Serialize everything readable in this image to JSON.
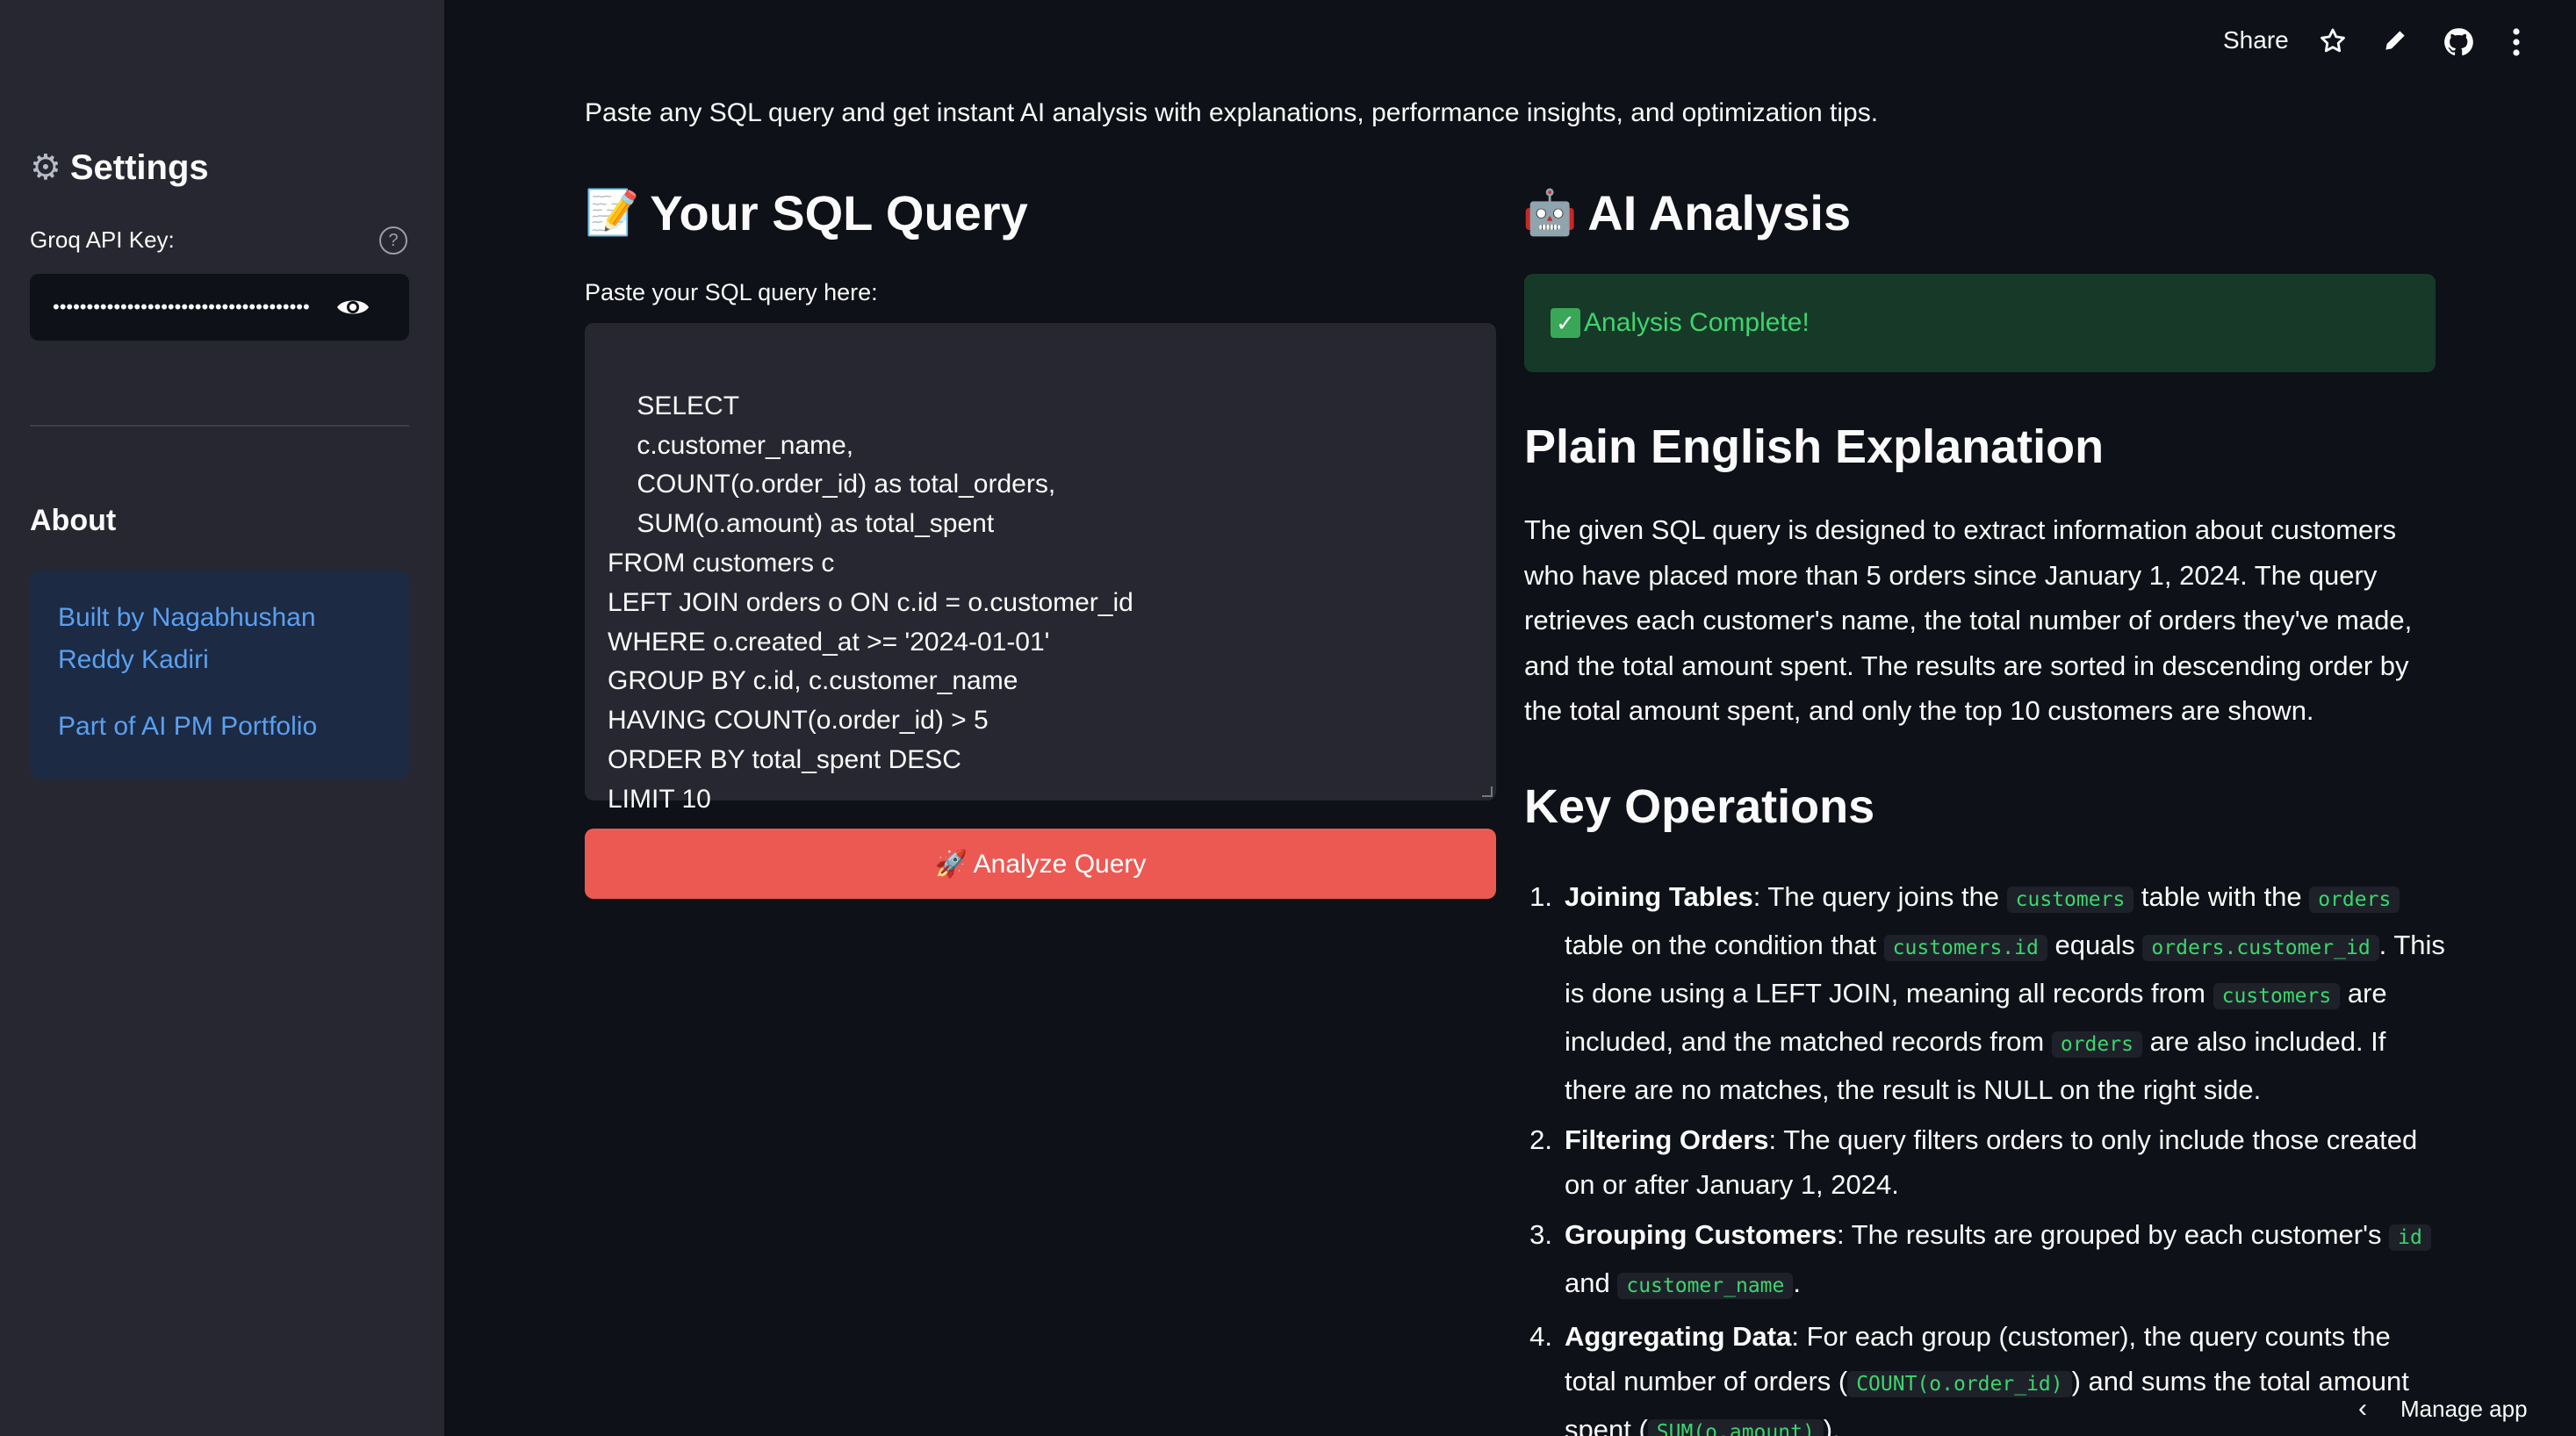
{
  "sidebar": {
    "settings_title": "Settings",
    "api_key_label": "Groq API Key:",
    "api_key_value": "••••••••••••••••••••••••••••••••••••••",
    "about_title": "About",
    "author_link": "Built by Nagabhushan Reddy Kadiri",
    "portfolio_link": "Part of AI PM Portfolio"
  },
  "header": {
    "share_label": "Share"
  },
  "main": {
    "intro": "Paste any SQL query and get instant AI analysis with explanations, performance insights, and optimization tips.",
    "left_heading": "Your SQL Query",
    "left_heading_emoji": "📝",
    "input_label": "Paste your SQL query here:",
    "sql_query": "SELECT\n    c.customer_name,\n    COUNT(o.order_id) as total_orders,\n    SUM(o.amount) as total_spent\nFROM customers c\nLEFT JOIN orders o ON c.id = o.customer_id\nWHERE o.created_at >= '2024-01-01'\nGROUP BY c.id, c.customer_name\nHAVING COUNT(o.order_id) > 5\nORDER BY total_spent DESC\nLIMIT 10",
    "analyze_button": "🚀 Analyze Query",
    "right_heading": "AI Analysis",
    "right_heading_emoji": "🤖",
    "success_message": "Analysis Complete!",
    "explanation_heading": "Plain English Explanation",
    "explanation_text": "The given SQL query is designed to extract information about customers who have placed more than 5 orders since January 1, 2024. The query retrieves each customer's name, the total number of orders they've made, and the total amount spent. The results are sorted in descending order by the total amount spent, and only the top 10 customers are shown.",
    "operations_heading": "Key Operations",
    "op1_title": "Joining Tables",
    "op2_title": "Filtering Orders",
    "op2_text": ": The query filters orders to only include those created on or after January 1, 2024.",
    "op3_title": "Grouping Customers",
    "op4_title": "Aggregating Data"
  },
  "footer": {
    "manage_app": "Manage app"
  },
  "colors": {
    "background": "#0e1117",
    "sidebar": "#262730",
    "accent_button": "#ec5953",
    "success_text": "#3dd56d",
    "link": "#5aa0f0"
  }
}
